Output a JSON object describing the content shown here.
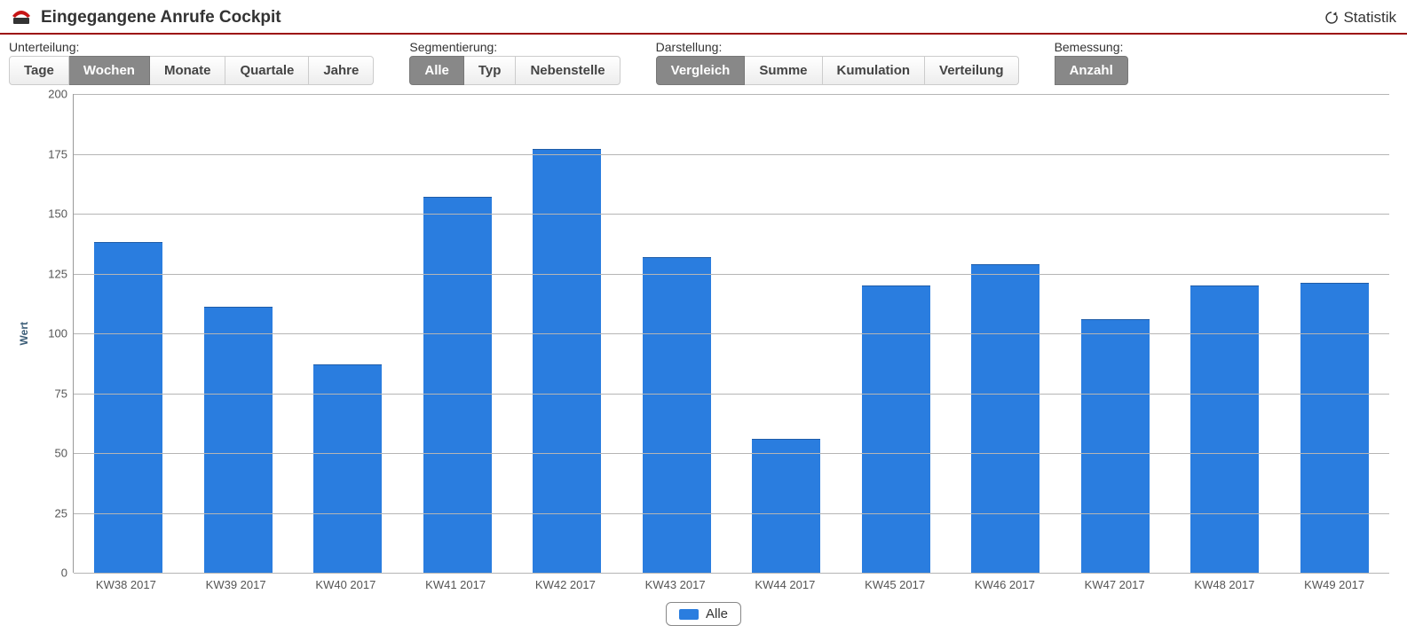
{
  "header": {
    "title": "Eingegangene Anrufe Cockpit",
    "statistik_label": "Statistik"
  },
  "toolbar": {
    "groups": [
      {
        "label": "Unterteilung:",
        "items": [
          {
            "label": "Tage",
            "active": false
          },
          {
            "label": "Wochen",
            "active": true
          },
          {
            "label": "Monate",
            "active": false
          },
          {
            "label": "Quartale",
            "active": false
          },
          {
            "label": "Jahre",
            "active": false
          }
        ]
      },
      {
        "label": "Segmentierung:",
        "items": [
          {
            "label": "Alle",
            "active": true
          },
          {
            "label": "Typ",
            "active": false
          },
          {
            "label": "Nebenstelle",
            "active": false
          }
        ]
      },
      {
        "label": "Darstellung:",
        "items": [
          {
            "label": "Vergleich",
            "active": true
          },
          {
            "label": "Summe",
            "active": false
          },
          {
            "label": "Kumulation",
            "active": false
          },
          {
            "label": "Verteilung",
            "active": false
          }
        ]
      },
      {
        "label": "Bemessung:",
        "items": [
          {
            "label": "Anzahl",
            "active": true
          }
        ]
      }
    ]
  },
  "chart_data": {
    "type": "bar",
    "ylabel": "Wert",
    "xlabel": "",
    "ylim": [
      0,
      200
    ],
    "y_ticks": [
      0,
      25,
      50,
      75,
      100,
      125,
      150,
      175,
      200
    ],
    "categories": [
      "KW38 2017",
      "KW39 2017",
      "KW40 2017",
      "KW41 2017",
      "KW42 2017",
      "KW43 2017",
      "KW44 2017",
      "KW45 2017",
      "KW46 2017",
      "KW47 2017",
      "KW48 2017",
      "KW49 2017"
    ],
    "series": [
      {
        "name": "Alle",
        "values": [
          138,
          111,
          87,
          157,
          177,
          132,
          56,
          120,
          129,
          106,
          120,
          121
        ]
      }
    ],
    "legend": {
      "items": [
        "Alle"
      ]
    }
  }
}
